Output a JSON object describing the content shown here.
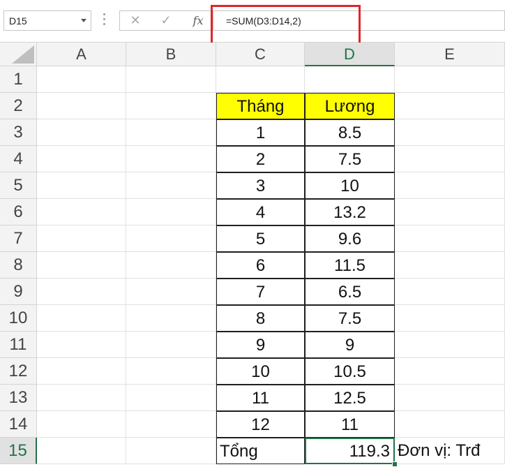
{
  "name_box": {
    "value": "D15"
  },
  "formula_bar": {
    "cancel_icon": "x-icon",
    "enter_icon": "check-icon",
    "fx_label": "fx",
    "formula": "=SUM(D3:D14,2)"
  },
  "columns": [
    "A",
    "B",
    "C",
    "D",
    "E"
  ],
  "selected_column": "D",
  "rows": [
    "1",
    "2",
    "3",
    "4",
    "5",
    "6",
    "7",
    "8",
    "9",
    "10",
    "11",
    "12",
    "13",
    "14",
    "15"
  ],
  "selected_row": "15",
  "table": {
    "headers": {
      "month": "Tháng",
      "salary": "Lương"
    },
    "header_color": "#ffff00",
    "data": [
      {
        "month": "1",
        "salary": "8.5"
      },
      {
        "month": "2",
        "salary": "7.5"
      },
      {
        "month": "3",
        "salary": "10"
      },
      {
        "month": "4",
        "salary": "13.2"
      },
      {
        "month": "5",
        "salary": "9.6"
      },
      {
        "month": "6",
        "salary": "11.5"
      },
      {
        "month": "7",
        "salary": "6.5"
      },
      {
        "month": "8",
        "salary": "7.5"
      },
      {
        "month": "9",
        "salary": "9"
      },
      {
        "month": "10",
        "salary": "10.5"
      },
      {
        "month": "11",
        "salary": "12.5"
      },
      {
        "month": "12",
        "salary": "11"
      }
    ],
    "total_label": "Tổng",
    "total_value": "119.3",
    "unit_note": "Đơn vị: Trđ"
  },
  "accent_color": "#217346",
  "highlight_color": "#e0252b"
}
